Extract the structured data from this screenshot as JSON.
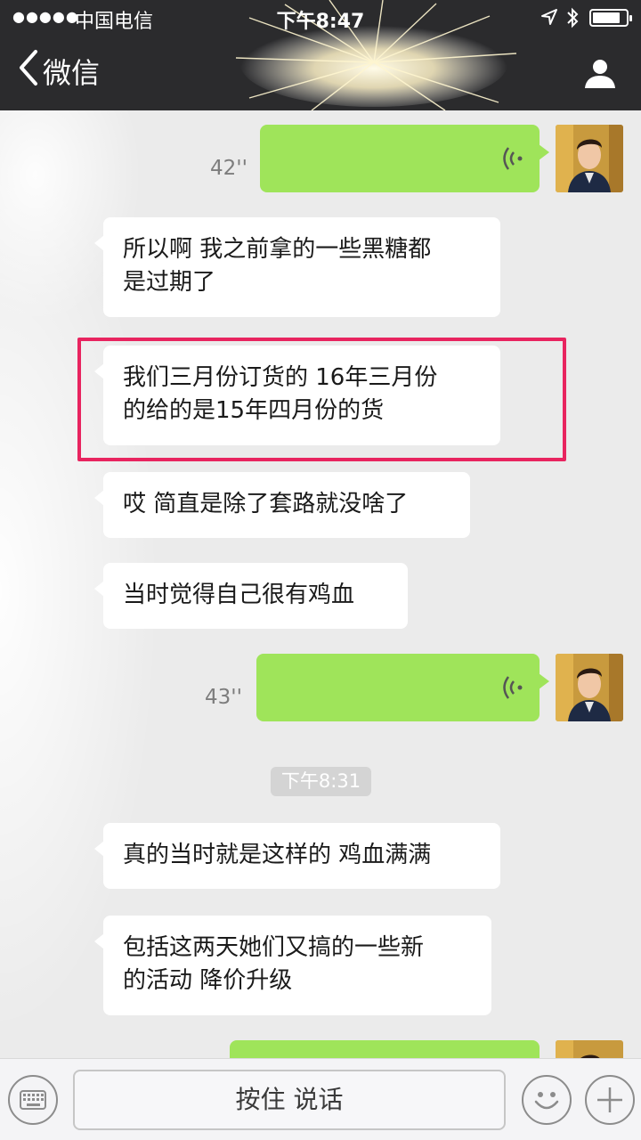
{
  "status_bar": {
    "signal_dots": "●●●●●",
    "carrier": "中国电信",
    "time": "下午8:47"
  },
  "nav": {
    "back_label": "微信"
  },
  "messages": [
    {
      "type": "voice",
      "direction": "outgoing",
      "duration": "42''"
    },
    {
      "type": "text",
      "direction": "incoming",
      "lines": [
        "所以啊 我之前拿的一些黑糖都",
        "是过期了"
      ]
    },
    {
      "type": "text",
      "direction": "incoming",
      "lines": [
        "我们三月份订货的 16年三月份",
        "的给的是15年四月份的货"
      ],
      "highlighted": true
    },
    {
      "type": "text",
      "direction": "incoming",
      "lines": [
        "哎 简直是除了套路就没啥了"
      ]
    },
    {
      "type": "text",
      "direction": "incoming",
      "lines": [
        "当时觉得自己很有鸡血"
      ]
    },
    {
      "type": "voice",
      "direction": "outgoing",
      "duration": "43''"
    },
    {
      "type": "timestamp",
      "text": "下午8:31"
    },
    {
      "type": "text",
      "direction": "incoming",
      "lines": [
        "真的当时就是这样的 鸡血满满"
      ]
    },
    {
      "type": "text",
      "direction": "incoming",
      "lines": [
        "包括这两天她们又搞的一些新",
        "的活动 降价升级"
      ]
    },
    {
      "type": "voice",
      "direction": "outgoing"
    }
  ],
  "input_bar": {
    "talk_label": "按住 说话"
  },
  "colors": {
    "header_bg": "#2b2b2d",
    "voice_bubble": "#9fe45a",
    "highlight_border": "#e8245f",
    "chat_bg": "#ebebeb"
  },
  "icons": [
    "back-chevron-icon",
    "profile-icon",
    "location-icon",
    "bluetooth-icon",
    "battery-icon",
    "voice-wave-icon",
    "keyboard-icon",
    "emoji-icon",
    "plus-icon"
  ]
}
